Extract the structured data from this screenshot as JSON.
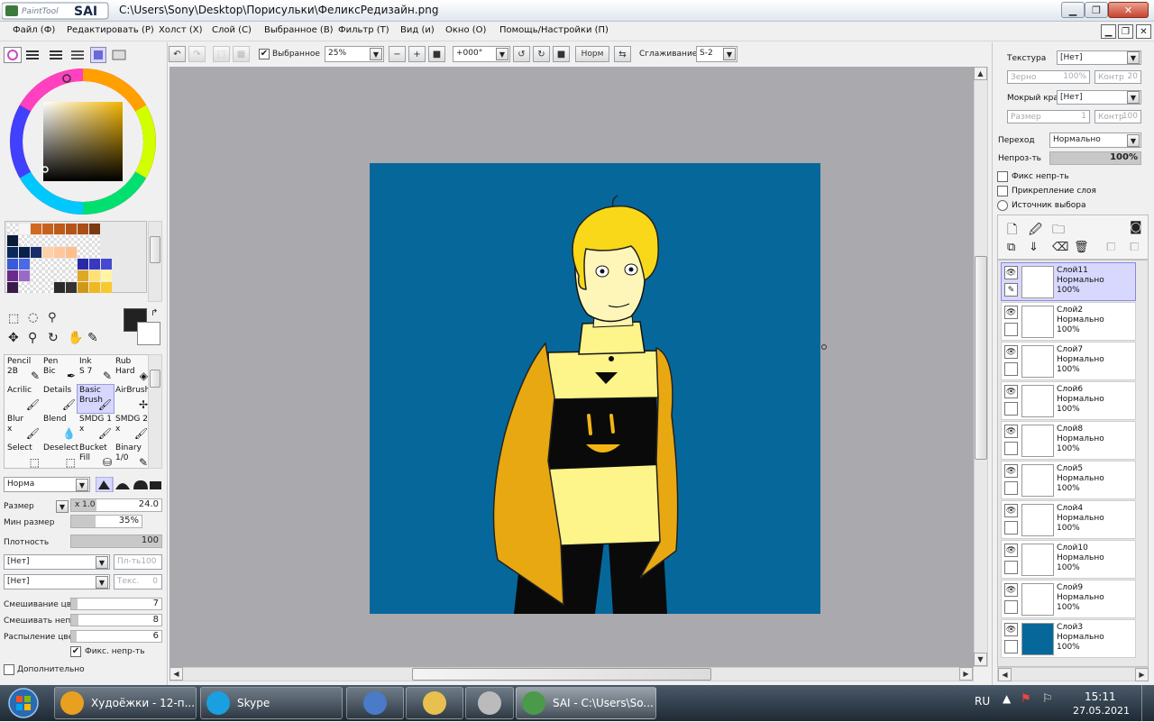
{
  "window": {
    "app_name": "PaintTool SAI",
    "title": "C:\\Users\\Sony\\Desktop\\Порисульки\\ФеликсРедизайн.png"
  },
  "menu": [
    "Файл (Ф)",
    "Редактировать (Р)",
    "Холст (Х)",
    "Слой (С)",
    "Выбранное (В)",
    "Фильтр (Т)",
    "Вид (и)",
    "Окно (О)",
    "Помощь/Настройки (П)"
  ],
  "toolbar": {
    "selection_checkbox_label": "Выбранное",
    "selection_checked": true,
    "zoom": "25%",
    "rotation": "+000°",
    "blend_button": "Норм",
    "smoothing_label": "Сглаживание",
    "smoothing_value": "S-2"
  },
  "palette": {
    "swatches_row1": [
      "#ffffff",
      "#f5f5f5",
      "#d2691e",
      "#c8611c",
      "#be5a1a",
      "#b45418",
      "#aa4e16",
      "#7a3a12"
    ],
    "swatches_row2": [
      "#0b1b3b",
      "#ffffff",
      "#ffffff",
      "#ffffff",
      "#ffffff",
      "#ffffff",
      "#ffffff",
      "#ffffff"
    ],
    "swatches_row3": [
      "#0a2a5c",
      "#0a1f4a",
      "#1a2c6a",
      "#ffd1a8",
      "#ffc89a",
      "#ffbe8c",
      "#ffffff",
      "#ffffff"
    ],
    "swatches_row4": [
      "#3a5ad8",
      "#4a6ae8",
      "#ffffff",
      "#ffffff",
      "#ffffff",
      "#ffffff",
      "#2a2aa8",
      "#3838c0",
      "#4848d0"
    ],
    "swatches_row5": [
      "#6a2a8a",
      "#9a6ac8",
      "#ffffff",
      "#ffffff",
      "#ffffff",
      "#ffffff",
      "#e0a820",
      "#ffe070",
      "#fff4a0"
    ],
    "swatches_row6": [
      "#3a1a4a",
      "#ffffff",
      "#ffffff",
      "#ffffff",
      "#2a2a2a",
      "#333333",
      "#d09818",
      "#f0b820",
      "#f8c830"
    ]
  },
  "tools": [
    {
      "label": "Pencil\n2B",
      "icon": "pencil-icon"
    },
    {
      "label": "Pen\nBic",
      "icon": "pen-icon"
    },
    {
      "label": "Ink\nS 7",
      "icon": "ink-icon"
    },
    {
      "label": "Rub\nHard",
      "icon": "eraser-icon"
    },
    {
      "label": "Acrilic",
      "icon": "brush-icon"
    },
    {
      "label": "Details",
      "icon": "brush-icon"
    },
    {
      "label": "Basic\nBrush",
      "icon": "brush-icon",
      "selected": true
    },
    {
      "label": "AirBrush",
      "icon": "airbrush-icon"
    },
    {
      "label": "Blur\nx",
      "icon": "brush-icon"
    },
    {
      "label": "Blend",
      "icon": "water-icon"
    },
    {
      "label": "SMDG 1\nx",
      "icon": "brush-icon"
    },
    {
      "label": "SMDG 2\nx",
      "icon": "brush-icon"
    },
    {
      "label": "Select",
      "icon": "select-icon"
    },
    {
      "label": "Deselect",
      "icon": "deselect-icon"
    },
    {
      "label": "Bucket\nFill",
      "icon": "bucket-icon"
    },
    {
      "label": "Binary\n1/0",
      "icon": "pencil-icon"
    }
  ],
  "brush_settings": {
    "blend_mode": "Норма",
    "size_label": "Размер",
    "size_multiplier": "x 1.0",
    "size_value": "24.0",
    "min_size_label": "Мин размер",
    "min_size_value": "35%",
    "min_size_fill": 0.35,
    "density_label": "Плотность",
    "density_value": "100",
    "texture1": "[Нет]",
    "texture1_strength": "Пл-ть100",
    "texture2": "[Нет]",
    "texture2_label": "Текс.",
    "texture2_value": "0",
    "mix_color_label": "Смешивание цвет",
    "mix_color_value": "7",
    "mix_opacity_label": "Смешивать непро",
    "mix_opacity_value": "8",
    "spray_label": "Распыление цвет",
    "spray_value": "6",
    "fix_opacity_label": "Фикс. непр-ть",
    "fix_opacity_checked": true,
    "advanced_label": "Дополнительно"
  },
  "right_panel": {
    "texture_label": "Текстура",
    "texture_value": "[Нет]",
    "grain_label": "Зерно",
    "grain_value": "100%",
    "contrast_label": "Контр",
    "contrast_value": "20",
    "wet_edge_label": "Мокрый край",
    "wet_edge_value": "[Нет]",
    "size_label": "Размер",
    "size_value": "1",
    "contrast2_label": "Контр",
    "contrast2_value": "100",
    "blend_label": "Переход",
    "blend_value": "Нормально",
    "opacity_label": "Непроз-ть",
    "opacity_value": "100%",
    "fix_opacity": "Фикс непр-ть",
    "clipping": "Прикрепление слоя",
    "selection_source": "Источник выбора"
  },
  "layers": [
    {
      "name": "Слой11",
      "mode": "Нормально",
      "opacity": "100%",
      "selected": true,
      "thumb": "#ffffff"
    },
    {
      "name": "Слой2",
      "mode": "Нормально",
      "opacity": "100%",
      "thumb": "#ffffff"
    },
    {
      "name": "Слой7",
      "mode": "Нормально",
      "opacity": "100%",
      "thumb": "#ffffff"
    },
    {
      "name": "Слой6",
      "mode": "Нормально",
      "opacity": "100%",
      "thumb": "#ffffff"
    },
    {
      "name": "Слой8",
      "mode": "Нормально",
      "opacity": "100%",
      "thumb": "#ffffff"
    },
    {
      "name": "Слой5",
      "mode": "Нормально",
      "opacity": "100%",
      "thumb": "#ffffff"
    },
    {
      "name": "Слой4",
      "mode": "Нормально",
      "opacity": "100%",
      "thumb": "#ffffff"
    },
    {
      "name": "Слой10",
      "mode": "Нормально",
      "opacity": "100%",
      "thumb": "#ffffff"
    },
    {
      "name": "Слой9",
      "mode": "Нормально",
      "opacity": "100%",
      "thumb": "#ffffff"
    },
    {
      "name": "Слой3",
      "mode": "Нормально",
      "opacity": "100%",
      "thumb": "#06689a"
    }
  ],
  "canvas": {
    "background": "#aaa9ad",
    "artboard_color": "#06689a"
  },
  "taskbar": {
    "apps": [
      {
        "label": "Худоёжки - 12-п...",
        "icon": "chrome-icon"
      },
      {
        "label": "Skype",
        "icon": "skype-icon"
      },
      {
        "label": "",
        "icon": "magnifier-app-icon"
      },
      {
        "label": "",
        "icon": "folder-icon"
      },
      {
        "label": "",
        "icon": "film-reel-icon"
      },
      {
        "label": "SAI - C:\\Users\\So...",
        "icon": "sai-icon",
        "active": true
      }
    ],
    "language": "RU",
    "time": "15:11",
    "date": "27.05.2021"
  }
}
